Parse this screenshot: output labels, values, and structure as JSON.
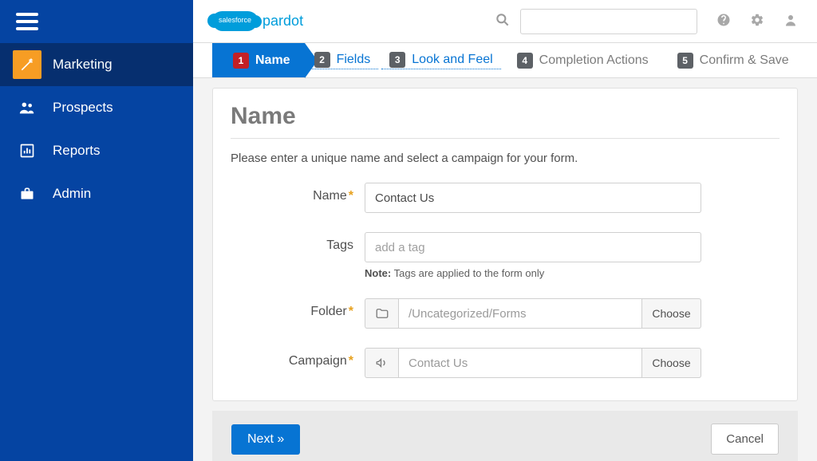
{
  "brand": {
    "cloud_text": "salesforce",
    "name": "pardot"
  },
  "sidebar": {
    "items": [
      {
        "label": "Marketing"
      },
      {
        "label": "Prospects"
      },
      {
        "label": "Reports"
      },
      {
        "label": "Admin"
      }
    ]
  },
  "steps": [
    {
      "num": "1",
      "label": "Name"
    },
    {
      "num": "2",
      "label": "Fields"
    },
    {
      "num": "3",
      "label": "Look and Feel"
    },
    {
      "num": "4",
      "label": "Completion Actions"
    },
    {
      "num": "5",
      "label": "Confirm & Save"
    }
  ],
  "panel": {
    "title": "Name",
    "intro": "Please enter a unique name and select a campaign for your form.",
    "name_label": "Name",
    "name_value": "Contact Us",
    "tags_label": "Tags",
    "tags_placeholder": "add a tag",
    "tags_note_prefix": "Note:",
    "tags_note": "Tags are applied to the form only",
    "folder_label": "Folder",
    "folder_value": "/Uncategorized/Forms",
    "campaign_label": "Campaign",
    "campaign_value": "Contact Us",
    "choose_label": "Choose"
  },
  "footer": {
    "next": "Next »",
    "cancel": "Cancel"
  }
}
